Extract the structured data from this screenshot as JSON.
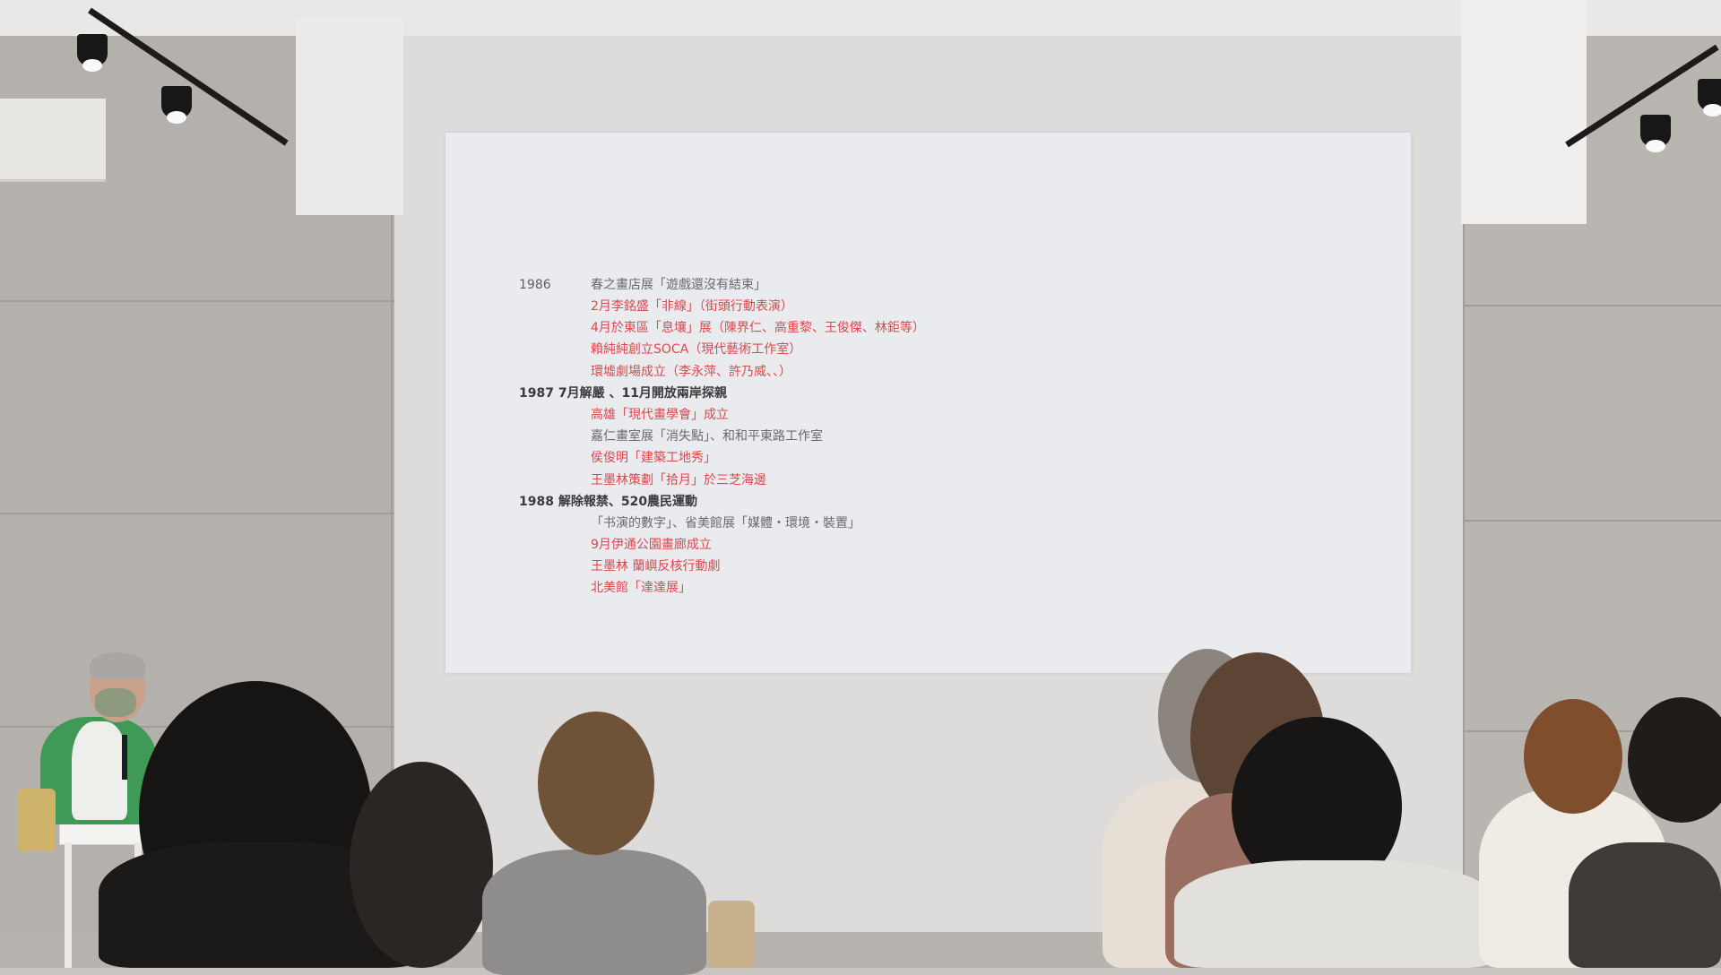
{
  "slide": {
    "year_1986": "1986",
    "items_1986": [
      {
        "text": "春之畫店展「遊戲還沒有結束」",
        "tone": "gray"
      },
      {
        "text": "2月李銘盛「非線」（街頭行動表演）",
        "tone": "red"
      },
      {
        "text": "4月於東區「息壤」展（陳界仁、高重黎、王俊傑、林鉅等）",
        "tone": "red"
      },
      {
        "text": "賴純純創立SOCA（現代藝術工作室）",
        "tone": "red"
      },
      {
        "text": "環墟劇場成立（李永萍、許乃威、、）",
        "tone": "red"
      }
    ],
    "header_1987": "1987 7月解嚴 、11月開放兩岸探親",
    "items_1987": [
      {
        "text": "高雄「現代畫學會」成立",
        "tone": "red"
      },
      {
        "text": "嘉仁畫室展「消失點」、和和平東路工作室",
        "tone": "gray"
      },
      {
        "text": "侯俊明「建築工地秀」",
        "tone": "red"
      },
      {
        "text": "王墨林策劃「拾月」於三芝海邊",
        "tone": "red"
      }
    ],
    "header_1988": "1988 解除報禁、520農民運動",
    "items_1988": [
      {
        "text": "「书演的數字」、省美館展「媒體・環境・裝置」",
        "tone": "gray"
      },
      {
        "text": "9月伊通公園畫廊成立",
        "tone": "red"
      },
      {
        "text": "王墨林 蘭嶼反核行動劇",
        "tone": "red"
      },
      {
        "text": "北美館「達達展」",
        "tone": "red"
      }
    ]
  },
  "colors": {
    "red": "#d9494e",
    "gray": "#6a6a6a",
    "screen": "#e9ebee"
  }
}
